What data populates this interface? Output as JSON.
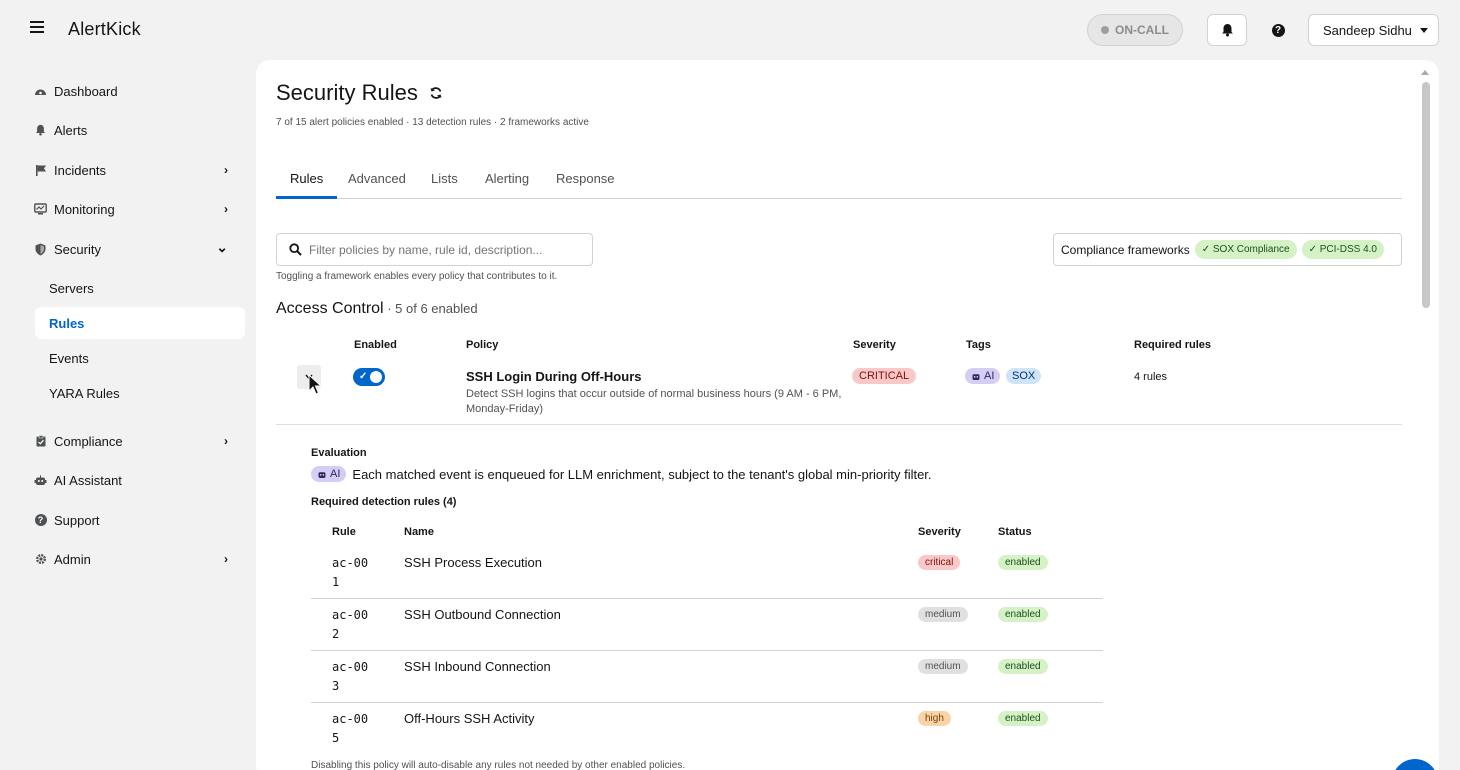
{
  "app": {
    "brand": "AlertKick"
  },
  "header": {
    "oncall_label": "ON-CALL",
    "bell_icon": "bell-icon",
    "help_icon": "help-icon",
    "user_name": "Sandeep Sidhu"
  },
  "sidebar": {
    "items": [
      {
        "label": "Dashboard",
        "icon": "dashboard-icon",
        "chevron": ""
      },
      {
        "label": "Alerts",
        "icon": "bell-icon",
        "chevron": ""
      },
      {
        "label": "Incidents",
        "icon": "flag-icon",
        "chevron": "›"
      },
      {
        "label": "Monitoring",
        "icon": "monitor-icon",
        "chevron": "›"
      },
      {
        "label": "Security",
        "icon": "shield-icon",
        "chevron": "⌄"
      },
      {
        "label": "Compliance",
        "icon": "clipboard-icon",
        "chevron": "›"
      },
      {
        "label": "AI Assistant",
        "icon": "robot-icon",
        "chevron": ""
      },
      {
        "label": "Support",
        "icon": "question-icon",
        "chevron": ""
      },
      {
        "label": "Admin",
        "icon": "gear-icon",
        "chevron": "›"
      }
    ],
    "security_sub": [
      "Servers",
      "Rules",
      "Events",
      "YARA Rules"
    ],
    "active_sub": "Rules"
  },
  "page": {
    "title": "Security Rules",
    "subtitle": "7 of 15 alert policies enabled · 13 detection rules · 2 frameworks active",
    "tabs": [
      "Rules",
      "Advanced",
      "Lists",
      "Alerting",
      "Response"
    ],
    "active_tab": "Rules",
    "search_placeholder": "Filter policies by name, rule id, description...",
    "hint": "Toggling a framework enables every policy that contributes to it.",
    "frameworks_label": "Compliance frameworks",
    "frameworks": [
      "✓ SOX Compliance",
      "✓ PCI-DSS 4.0"
    ]
  },
  "section": {
    "title": "Access Control",
    "count": " · 5 of 6 enabled",
    "columns": {
      "enabled": "Enabled",
      "policy": "Policy",
      "severity": "Severity",
      "tags": "Tags",
      "required": "Required rules"
    }
  },
  "policy": {
    "enabled": true,
    "name": "SSH Login During Off-Hours",
    "description": "Detect SSH logins that occur outside of normal business hours (9 AM - 6 PM, Monday-Friday)",
    "severity": "CRITICAL",
    "tags": [
      "AI",
      "SOX"
    ],
    "required_rules": "4 rules"
  },
  "evaluation": {
    "heading": "Evaluation",
    "ai_chip": "AI",
    "text": "Each matched event is enqueued for LLM enrichment, subject to the tenant's global min-priority filter.",
    "required_heading": "Required detection rules (4)",
    "columns": {
      "rule": "Rule",
      "name": "Name",
      "severity": "Severity",
      "status": "Status"
    },
    "rules": [
      {
        "id": "ac-001",
        "name": "SSH Process Execution",
        "severity": "critical",
        "status": "enabled"
      },
      {
        "id": "ac-002",
        "name": "SSH Outbound Connection",
        "severity": "medium",
        "status": "enabled"
      },
      {
        "id": "ac-003",
        "name": "SSH Inbound Connection",
        "severity": "medium",
        "status": "enabled"
      },
      {
        "id": "ac-005",
        "name": "Off-Hours SSH Activity",
        "severity": "high",
        "status": "enabled"
      }
    ],
    "footnote": "Disabling this policy will auto-disable any rules not needed by other enabled policies."
  }
}
